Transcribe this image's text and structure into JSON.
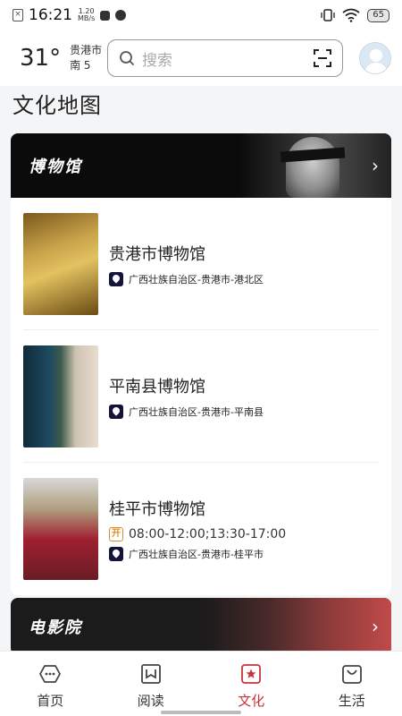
{
  "status": {
    "time": "16:21",
    "speed_top": "1.20",
    "speed_bottom": "MB/s",
    "battery": "65"
  },
  "header": {
    "temperature": "31°",
    "city": "贵港市",
    "district": "南 5",
    "search_placeholder": "搜索"
  },
  "page_title": "文化地图",
  "museum_section": {
    "banner_title": "博物馆",
    "items": [
      {
        "name": "贵港市博物馆",
        "address": "广西壮族自治区-贵港市-港北区"
      },
      {
        "name": "平南县博物馆",
        "address": "广西壮族自治区-贵港市-平南县"
      },
      {
        "name": "桂平市博物馆",
        "hours": "08:00-12:00;13:30-17:00",
        "address": "广西壮族自治区-贵港市-桂平市",
        "open_label": "开"
      }
    ]
  },
  "cinema_section": {
    "banner_title": "电影院"
  },
  "bottom_nav": {
    "items": [
      {
        "label": "首页"
      },
      {
        "label": "阅读"
      },
      {
        "label": "文化"
      },
      {
        "label": "生活"
      }
    ],
    "active_color": "#c8343a"
  }
}
